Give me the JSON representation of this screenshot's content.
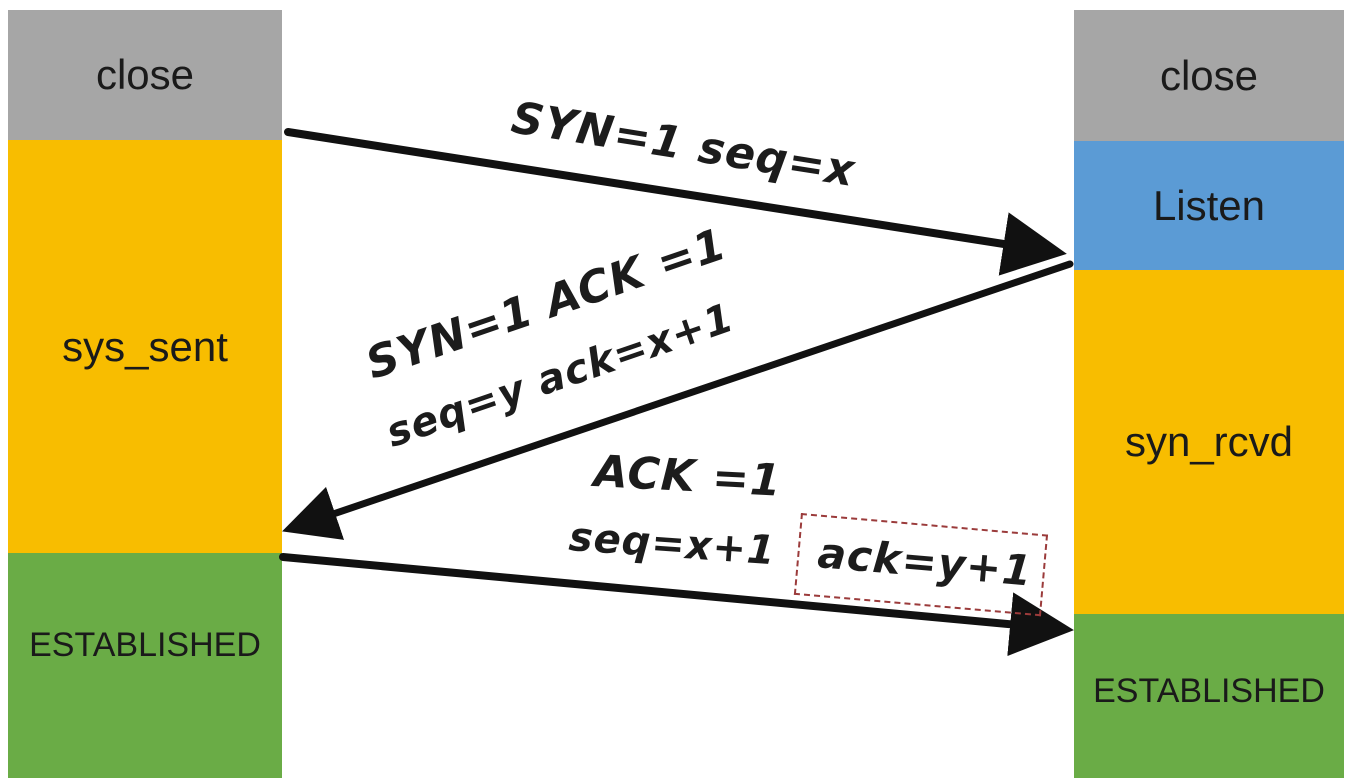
{
  "client": {
    "states": [
      {
        "label": "close",
        "color": "#a6a6a6"
      },
      {
        "label": "sys_sent",
        "color": "#f8bd00"
      },
      {
        "label": "ESTABLISHED",
        "color": "#6aac46"
      }
    ]
  },
  "server": {
    "states": [
      {
        "label": "close",
        "color": "#a6a6a6"
      },
      {
        "label": "Listen",
        "color": "#5b9bd5"
      },
      {
        "label": "syn_rcvd",
        "color": "#f8bd00"
      },
      {
        "label": "ESTABLISHED",
        "color": "#6aac46"
      }
    ]
  },
  "messages": {
    "first": {
      "text": "SYN=1 seq=x"
    },
    "second": {
      "line1": "SYN=1   ACK =1",
      "line2": "seq=y   ack=x+1"
    },
    "third": {
      "line1": "ACK =1",
      "line2": "seq=x+1",
      "boxed": "ack=y+1"
    }
  },
  "colors": {
    "arrow": "#111111",
    "box_border": "#9b3b3b"
  }
}
